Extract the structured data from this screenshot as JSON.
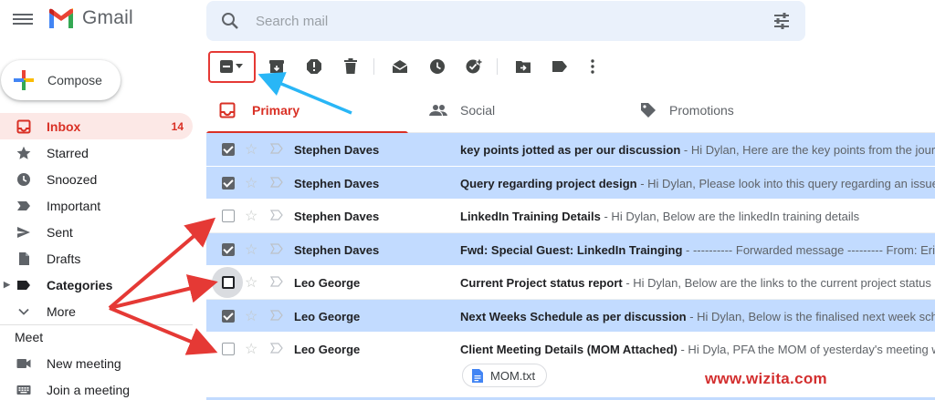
{
  "header": {
    "app_name": "Gmail",
    "search_placeholder": "Search mail"
  },
  "sidebar": {
    "compose_label": "Compose",
    "items": [
      {
        "label": "Inbox",
        "count": "14",
        "icon": "inbox-icon",
        "active": true
      },
      {
        "label": "Starred",
        "icon": "star-icon"
      },
      {
        "label": "Snoozed",
        "icon": "clock-icon"
      },
      {
        "label": "Important",
        "icon": "label-important-icon"
      },
      {
        "label": "Sent",
        "icon": "send-icon"
      },
      {
        "label": "Drafts",
        "icon": "draft-icon"
      },
      {
        "label": "Categories",
        "icon": "label-icon"
      },
      {
        "label": "More",
        "icon": "chevron-down-icon"
      }
    ],
    "meet": {
      "title": "Meet",
      "items": [
        {
          "label": "New meeting",
          "icon": "video-icon"
        },
        {
          "label": "Join a meeting",
          "icon": "keyboard-icon"
        }
      ]
    }
  },
  "toolbar": {
    "buttons": [
      "select-partial",
      "archive",
      "report-spam",
      "delete",
      "mark-as-read",
      "snooze",
      "add-to-tasks",
      "move-to",
      "labels",
      "more"
    ]
  },
  "tabs": [
    {
      "label": "Primary",
      "icon": "inbox-icon",
      "active": true
    },
    {
      "label": "Social",
      "icon": "people-icon"
    },
    {
      "label": "Promotions",
      "icon": "tag-icon"
    }
  ],
  "emails": [
    {
      "sender": "Stephen Daves",
      "subject": "key points jotted as per our discussion",
      "snippet": " - Hi Dylan, Here are the key points from the journal",
      "selected": true
    },
    {
      "sender": "Stephen Daves",
      "subject": "Query regarding project design",
      "snippet": " - Hi Dylan, Please look into this query regarding an issue in",
      "selected": true
    },
    {
      "sender": "Stephen Daves",
      "subject": "LinkedIn Training Details",
      "snippet": " - Hi Dylan, Below are the linkedIn training details",
      "selected": false
    },
    {
      "sender": "Stephen Daves",
      "subject": "Fwd: Special Guest: LinkedIn Trainging",
      "snippet": " - ---------- Forwarded message --------- From: Eric Lou",
      "selected": true
    },
    {
      "sender": "Leo George",
      "subject": "Current Project status report",
      "snippet": " - Hi Dylan, Below are the links to the current project status re",
      "selected": false,
      "hover": true
    },
    {
      "sender": "Leo George",
      "subject": "Next Weeks Schedule as per discussion",
      "snippet": " - Hi Dylan, Below is the finalised next week schec",
      "selected": true
    },
    {
      "sender": "Leo George",
      "subject": "Client Meeting Details (MOM Attached)",
      "snippet": " - Hi Dyla, PFA the MOM of yesterday's meeting wit",
      "selected": false,
      "attachment": "MOM.txt"
    }
  ],
  "watermark": "www.wizita.com",
  "colors": {
    "accent_red": "#d93025",
    "selected_row": "#c2dbff",
    "annotation_red": "#e53935",
    "annotation_blue": "#29b6f6"
  }
}
